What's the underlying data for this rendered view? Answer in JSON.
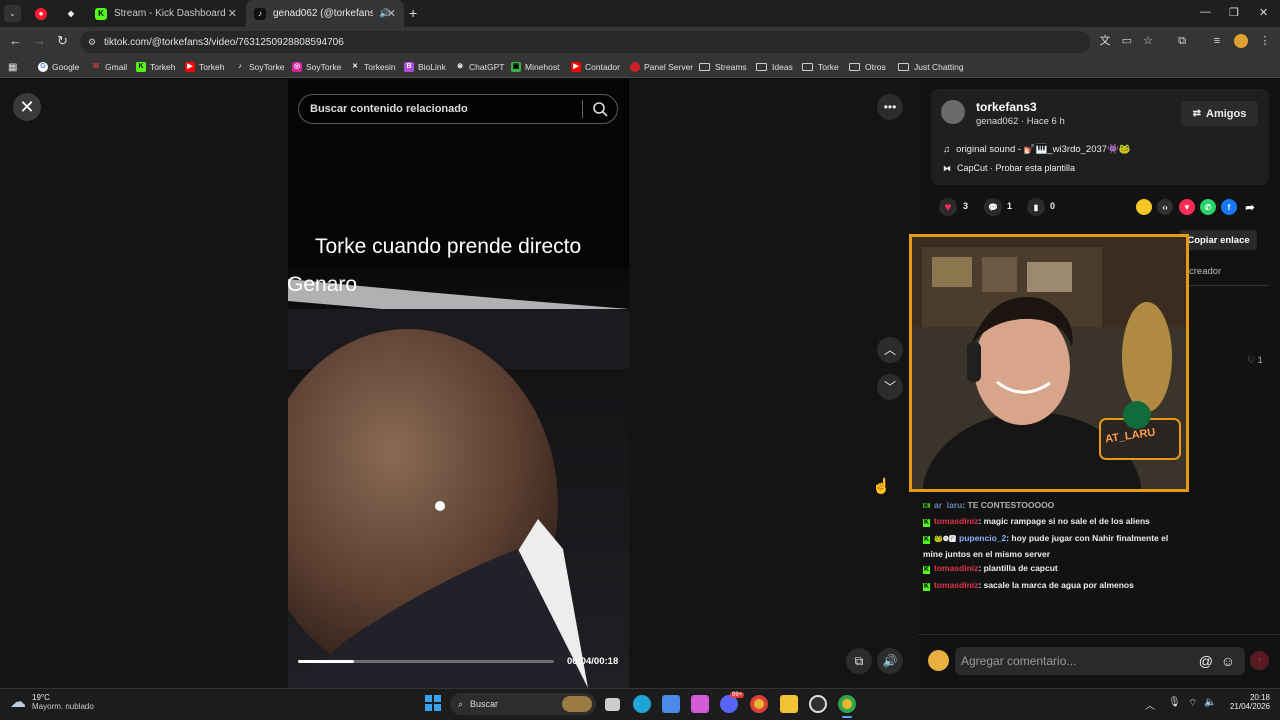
{
  "browser": {
    "tabs": [
      {
        "label": ""
      },
      {
        "label": ""
      },
      {
        "label": "Stream - Kick Dashboard"
      },
      {
        "label": "genad062 (@torkefans3) | T"
      }
    ],
    "new_tab": "+",
    "url": "tiktok.com/@torkefans3/video/7631250928808594706",
    "bookmarks": [
      {
        "label": "Google"
      },
      {
        "label": "Gmail"
      },
      {
        "label": "Torkeh"
      },
      {
        "label": "Torkeh"
      },
      {
        "label": "SoyTorke"
      },
      {
        "label": "SoyTorke"
      },
      {
        "label": "Torkesin"
      },
      {
        "label": "BioLink"
      },
      {
        "label": "ChatGPT"
      },
      {
        "label": "Minehost"
      },
      {
        "label": "Contador"
      },
      {
        "label": "Panel Server"
      },
      {
        "label": "Streams"
      },
      {
        "label": "Ideas"
      },
      {
        "label": "Torke"
      },
      {
        "label": "Otros"
      },
      {
        "label": "Just Chatting"
      }
    ]
  },
  "player": {
    "search_placeholder": "Buscar contenido relacionado",
    "caption1": "Torke cuando prende directo",
    "caption2": "Genaro",
    "time": "00:04/00:18",
    "progress": 0.22
  },
  "panel": {
    "username": "torkefans3",
    "sub": "genad062 · Hace 6 h",
    "friends_label": "Amigos",
    "sound": "original sound - 💅🏻🎹_wi3rdo_2037👾🐸",
    "capcut": "CapCut · Probar esta plantilla",
    "likes": "3",
    "comments": "1",
    "saves": "0",
    "copy_link": "Copiar enlace",
    "creator_tab": "creador",
    "comment_like_count": "1",
    "comment_placeholder": "Agregar comentario..."
  },
  "overlay": {
    "sign_text": "AT_LARU",
    "chat": [
      {
        "user": "ar_laru",
        "text": ": TE CONTESTOOOOO"
      },
      {
        "user": "tomasdiniz",
        "text": ": magic rampage si no sale el de los aliens"
      },
      {
        "user": "pupencio_2",
        "text": ": hoy pude jugar con Nahir finalmente el mine juntos en el mismo server"
      },
      {
        "user": "tomasdiniz",
        "text": ": plantilla de capcut"
      },
      {
        "user": "tomasdiniz",
        "text": ": sacale la marca de agua por almenos"
      }
    ]
  },
  "taskbar": {
    "temp": "19°C",
    "weather": "Mayorm. nublado",
    "search": "Buscar",
    "time": "20:18",
    "date": "21/04/2026",
    "badge": "99+"
  },
  "colors": {
    "kick_green": "#53fc18",
    "chat_red": "#e0334a",
    "chat_blue": "#8ab4ff",
    "cam_border": "#e69a13",
    "tiktok_like": "#fe2c55"
  }
}
